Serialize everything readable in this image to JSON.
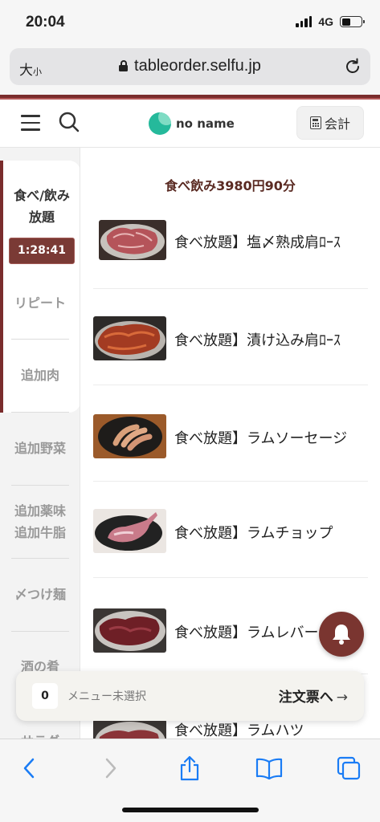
{
  "status_bar": {
    "time": "20:04",
    "network": "4G",
    "battery_level": 0.45
  },
  "browser": {
    "text_size_label": "大",
    "text_size_small": "小",
    "url": "tableorder.selfu.jp"
  },
  "header": {
    "store_name": "no name",
    "checkout_label": "会計"
  },
  "sidebar": {
    "active_category": {
      "label_line1": "食べ/飲み",
      "label_line2": "放題",
      "timer": "1:28:41"
    },
    "categories": [
      {
        "label_line1": "リピート",
        "label_line2": ""
      },
      {
        "label_line1": "追加肉",
        "label_line2": ""
      },
      {
        "label_line1": "追加野菜",
        "label_line2": ""
      },
      {
        "label_line1": "追加薬味",
        "label_line2": "追加牛脂"
      },
      {
        "label_line1": "〆つけ麺",
        "label_line2": ""
      },
      {
        "label_line1": "酒の肴",
        "label_line2": ""
      },
      {
        "label_line1": "サラダ",
        "label_line2": ""
      }
    ]
  },
  "main": {
    "plan_title": "食べ飲み3980円90分",
    "items": [
      {
        "name": "食べ放題】塩〆熟成肩ﾛｰｽ",
        "image": "raw-lamb-shoulder-photo"
      },
      {
        "name": "食べ放題】漬け込み肩ﾛｰｽ",
        "image": "marinated-lamb-photo"
      },
      {
        "name": "食べ放題】ラムソーセージ",
        "image": "lamb-sausage-photo"
      },
      {
        "name": "食べ放題】ラムチョップ",
        "image": "lamb-chop-photo"
      },
      {
        "name": "食べ放題】ラムレバー",
        "image": "lamb-liver-photo"
      },
      {
        "name": "食べ放題】ラムハツ",
        "image": "lamb-heart-photo"
      }
    ]
  },
  "order_bar": {
    "count": "0",
    "status": "メニュー未選択",
    "cta": "注文票へ",
    "arrow": "→"
  },
  "colors": {
    "accent": "#7a2c2c",
    "timer_bg": "#7a3a35",
    "logo": "#25b99b",
    "ios_blue": "#1a7cf5"
  },
  "icons": [
    "menu-icon",
    "search-icon",
    "calculator-icon",
    "bell-icon",
    "lock-icon",
    "reload-icon",
    "back-icon",
    "forward-icon",
    "share-icon",
    "bookmarks-icon",
    "tabs-icon"
  ]
}
